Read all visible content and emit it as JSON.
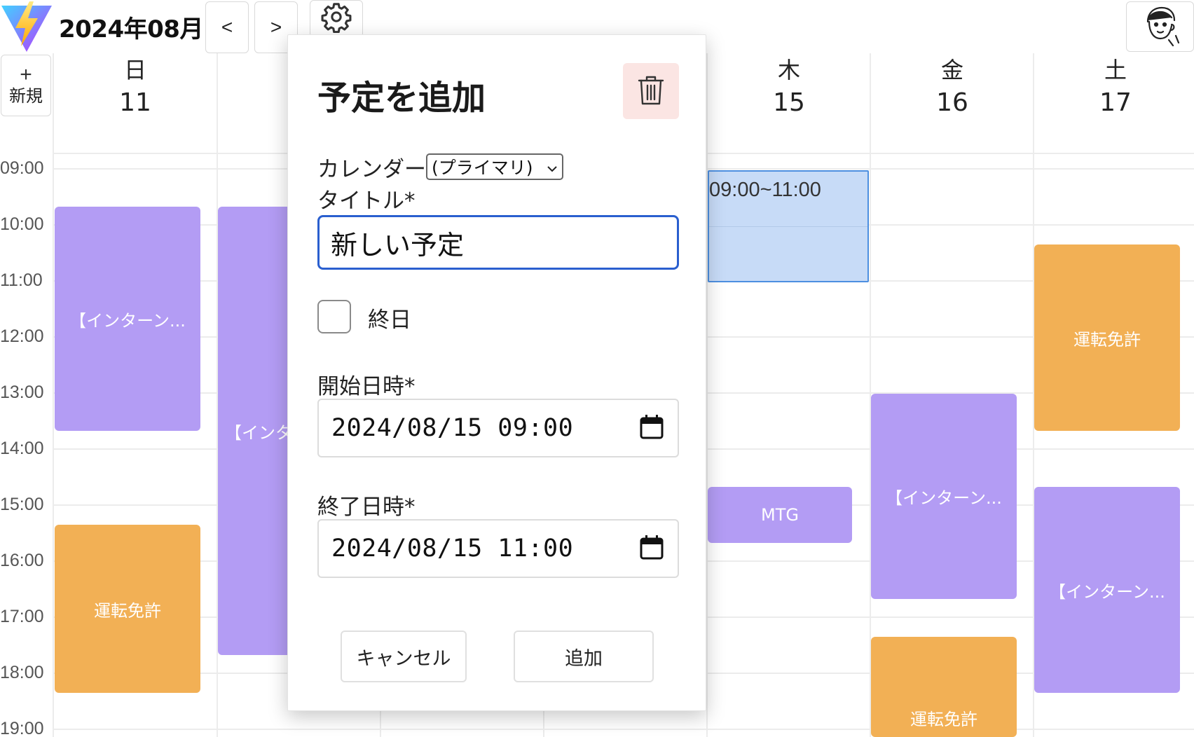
{
  "header": {
    "month_title": "2024年08月",
    "prev_label": "<",
    "next_label": ">",
    "settings_icon": "gear-icon",
    "avatar_icon": "user-avatar-icon"
  },
  "new_button": {
    "plus": "+",
    "label": "新規"
  },
  "days": [
    {
      "dow": "日",
      "date": "11"
    },
    {
      "dow": "木",
      "date": "15"
    },
    {
      "dow": "金",
      "date": "16"
    },
    {
      "dow": "土",
      "date": "17"
    }
  ],
  "time_labels": [
    "09:00",
    "10:00",
    "11:00",
    "12:00",
    "13:00",
    "14:00",
    "15:00",
    "16:00",
    "17:00",
    "18:00",
    "19:00"
  ],
  "events": [
    {
      "label": "【インターン...",
      "color": "#b39cf4"
    },
    {
      "label": "運転免許",
      "color": "#f2b055"
    },
    {
      "label": "【インタ",
      "color": "#b39cf4"
    },
    {
      "label": "MTG",
      "color": "#b39cf4"
    },
    {
      "label": "【インターン...",
      "color": "#b39cf4"
    },
    {
      "label": "運転免許",
      "color": "#f2b055"
    },
    {
      "label": "運転免許",
      "color": "#f2b055"
    },
    {
      "label": "【インターン...",
      "color": "#b39cf4"
    }
  ],
  "selected_slot": {
    "label": "09:00~11:00",
    "color": "#c7dbf7"
  },
  "modal": {
    "title": "予定を追加",
    "delete_icon": "trash-icon",
    "calendar_label": "カレンダー",
    "calendar_value": "(プライマリ)",
    "title_label": "タイトル*",
    "title_value": "新しい予定",
    "all_day_label": "終日",
    "start_label": "開始日時*",
    "start_value": "2024/08/15  09:00",
    "end_label": "終了日時*",
    "end_value": "2024/08/15  11:00",
    "cancel_label": "キャンセル",
    "add_label": "追加"
  }
}
